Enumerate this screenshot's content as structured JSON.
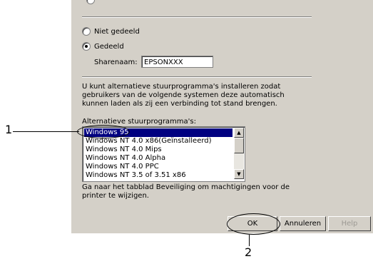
{
  "sharing": {
    "not_shared_label": "Niet gedeeld",
    "shared_label": "Gedeeld",
    "selected": "shared",
    "share_name_label": "Sharenaam:",
    "share_name_value": "EPSONXXX"
  },
  "drivers": {
    "description": "U kunt alternatieve stuurprogramma's installeren zodat gebruikers van de volgende systemen deze automatisch kunnen laden als zij een verbinding tot stand brengen.",
    "list_label": "Alternatieve stuurprogramma's:",
    "items": [
      "Windows 95",
      "Windows NT 4.0 x86(Geïnstalleerd)",
      "Windows NT 4.0 Mips",
      "Windows NT 4.0 Alpha",
      "Windows NT 4.0 PPC",
      "Windows NT 3.5 of 3.51 x86"
    ],
    "selected_index": 0
  },
  "hint": "Ga naar het tabblad Beveiliging om machtigingen voor de printer te wijzigen.",
  "buttons": {
    "ok": "OK",
    "cancel": "Annuleren",
    "help": "Help"
  },
  "callouts": {
    "one": "1",
    "two": "2"
  }
}
